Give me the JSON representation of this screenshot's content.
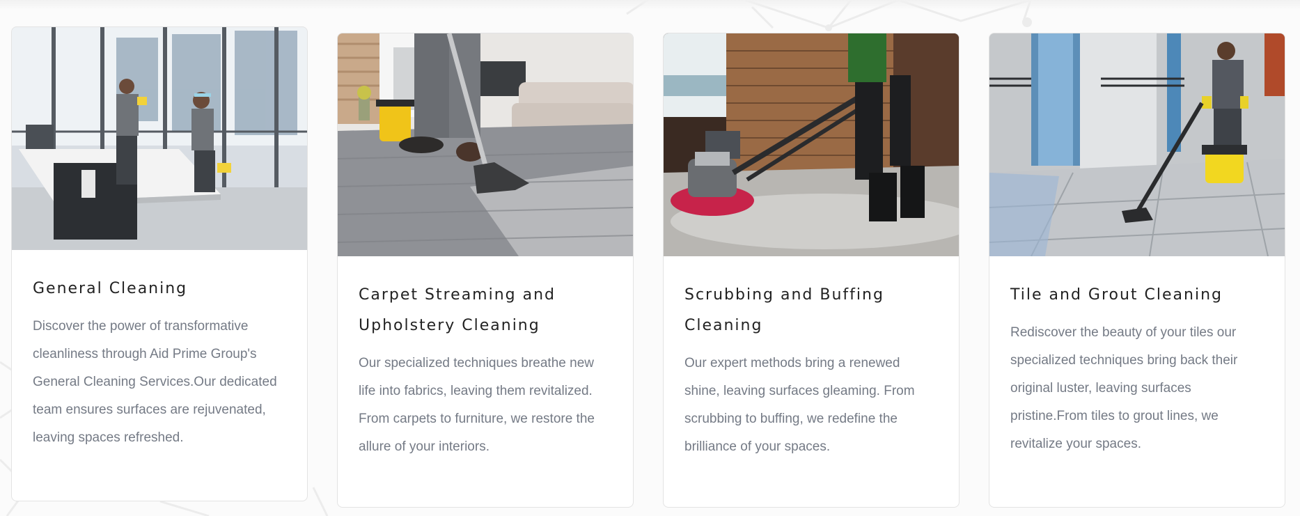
{
  "services": [
    {
      "image_alt": "Two cleaners in grey uniforms wiping desks and windows in a glass-walled office",
      "title": "General Cleaning",
      "description": "Discover the power of transformative cleanliness through Aid Prime Group's General Cleaning Services.Our dedicated team ensures surfaces are rejuvenated, leaving spaces refreshed."
    },
    {
      "image_alt": "Worker using a carpet extraction wand on grey carpet in a living room",
      "title": "Carpet Streaming and Upholstery Cleaning",
      "description": "Our specialized techniques breathe new life into fabrics, leaving them revitalized. From carpets to furniture, we restore the allure of your interiors."
    },
    {
      "image_alt": "Worker operating a floor buffing machine on a wet floor",
      "title": "Scrubbing and Buffing Cleaning",
      "description": "Our expert methods bring a renewed shine, leaving surfaces gleaming. From scrubbing to buffing, we redefine the brilliance of your spaces."
    },
    {
      "image_alt": "Worker vacuuming tiled floor with a yellow wet vacuum",
      "title": "Tile and Grout Cleaning",
      "description": "Rediscover the beauty of your tiles our specialized techniques bring back their original luster, leaving surfaces pristine.From tiles to grout lines, we revitalize your spaces."
    }
  ],
  "colors": {
    "title": "#222222",
    "text": "#747a85",
    "card_border": "#e3e3e3",
    "background": "#fbfbfb"
  }
}
